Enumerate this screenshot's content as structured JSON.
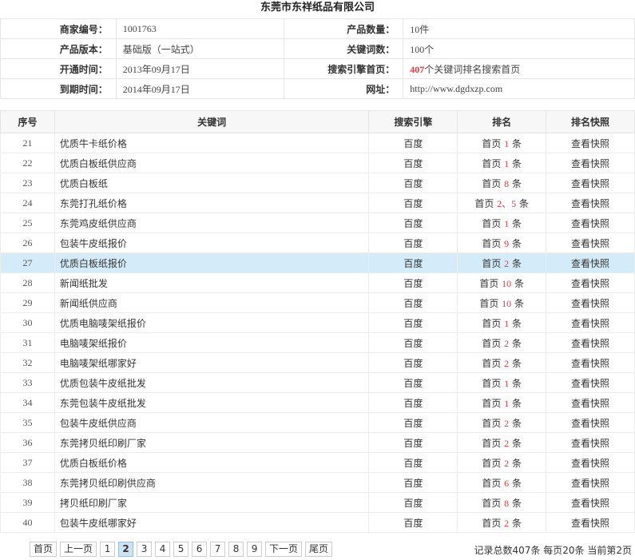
{
  "company": "东莞市东祥纸品有限公司",
  "info": {
    "merchant_id_label": "商家编号：",
    "merchant_id": "1001763",
    "product_count_label": "产品数量：",
    "product_count": "10件",
    "version_label": "产品版本：",
    "version": "基础版（一站式）",
    "keyword_count_label": "关键词数：",
    "keyword_count": "100个",
    "open_time_label": "开通时间：",
    "open_time": "2013年09月17日",
    "homepage_label": "搜索引擎首页：",
    "homepage_count": "407",
    "homepage_text": "个关键词排名搜索首页",
    "expire_label": "到期时间：",
    "expire_time": "2014年09月17日",
    "url_label": "网址：",
    "url": "http://www.dgdxzp.com"
  },
  "table": {
    "headers": [
      "序号",
      "关键词",
      "搜索引擎",
      "排名",
      "排名快照"
    ],
    "rows": [
      {
        "no": "21",
        "keyword": "优质牛卡纸价格",
        "engine": "百度",
        "rank_pre": "首页",
        "rank": "1",
        "rank_post": "条",
        "snapshot": "查看快照"
      },
      {
        "no": "22",
        "keyword": "优质白板纸供应商",
        "engine": "百度",
        "rank_pre": "首页",
        "rank": "1",
        "rank_post": "条",
        "snapshot": "查看快照"
      },
      {
        "no": "23",
        "keyword": "优质白板纸",
        "engine": "百度",
        "rank_pre": "首页",
        "rank": "8",
        "rank_post": "条",
        "snapshot": "查看快照"
      },
      {
        "no": "24",
        "keyword": "东莞打孔纸价格",
        "engine": "百度",
        "rank_pre": "首页",
        "rank": "2、5",
        "rank_post": "条",
        "snapshot": "查看快照"
      },
      {
        "no": "25",
        "keyword": "东莞鸡皮纸供应商",
        "engine": "百度",
        "rank_pre": "首页",
        "rank": "1",
        "rank_post": "条",
        "snapshot": "查看快照"
      },
      {
        "no": "26",
        "keyword": "包装牛皮纸报价",
        "engine": "百度",
        "rank_pre": "首页",
        "rank": "9",
        "rank_post": "条",
        "snapshot": "查看快照"
      },
      {
        "no": "27",
        "keyword": "优质白板纸报价",
        "engine": "百度",
        "rank_pre": "首页",
        "rank": "2",
        "rank_post": "条",
        "snapshot": "查看快照"
      },
      {
        "no": "28",
        "keyword": "新闻纸批发",
        "engine": "百度",
        "rank_pre": "首页",
        "rank": "10",
        "rank_post": "条",
        "snapshot": "查看快照"
      },
      {
        "no": "29",
        "keyword": "新闻纸供应商",
        "engine": "百度",
        "rank_pre": "首页",
        "rank": "10",
        "rank_post": "条",
        "snapshot": "查看快照"
      },
      {
        "no": "30",
        "keyword": "优质电脑唛架纸报价",
        "engine": "百度",
        "rank_pre": "首页",
        "rank": "1",
        "rank_post": "条",
        "snapshot": "查看快照"
      },
      {
        "no": "31",
        "keyword": "电脑唛架纸报价",
        "engine": "百度",
        "rank_pre": "首页",
        "rank": "2",
        "rank_post": "条",
        "snapshot": "查看快照"
      },
      {
        "no": "32",
        "keyword": "电脑唛架纸哪家好",
        "engine": "百度",
        "rank_pre": "首页",
        "rank": "2",
        "rank_post": "条",
        "snapshot": "查看快照"
      },
      {
        "no": "33",
        "keyword": "优质包装牛皮纸批发",
        "engine": "百度",
        "rank_pre": "首页",
        "rank": "1",
        "rank_post": "条",
        "snapshot": "查看快照"
      },
      {
        "no": "34",
        "keyword": "东莞包装牛皮纸批发",
        "engine": "百度",
        "rank_pre": "首页",
        "rank": "1",
        "rank_post": "条",
        "snapshot": "查看快照"
      },
      {
        "no": "35",
        "keyword": "包装牛皮纸供应商",
        "engine": "百度",
        "rank_pre": "首页",
        "rank": "2",
        "rank_post": "条",
        "snapshot": "查看快照"
      },
      {
        "no": "36",
        "keyword": "东莞拷贝纸印刷厂家",
        "engine": "百度",
        "rank_pre": "首页",
        "rank": "2",
        "rank_post": "条",
        "snapshot": "查看快照"
      },
      {
        "no": "37",
        "keyword": "优质白板纸价格",
        "engine": "百度",
        "rank_pre": "首页",
        "rank": "2",
        "rank_post": "条",
        "snapshot": "查看快照"
      },
      {
        "no": "38",
        "keyword": "东莞拷贝纸印刷供应商",
        "engine": "百度",
        "rank_pre": "首页",
        "rank": "6",
        "rank_post": "条",
        "snapshot": "查看快照"
      },
      {
        "no": "39",
        "keyword": "拷贝纸印刷厂家",
        "engine": "百度",
        "rank_pre": "首页",
        "rank": "8",
        "rank_post": "条",
        "snapshot": "查看快照"
      },
      {
        "no": "40",
        "keyword": "包装牛皮纸哪家好",
        "engine": "百度",
        "rank_pre": "首页",
        "rank": "2",
        "rank_post": "条",
        "snapshot": "查看快照"
      }
    ],
    "highlight_color": "#d4ecf9",
    "rank_color": "#e4393c"
  },
  "pager": {
    "first": "首页",
    "prev": "上一页",
    "pages": [
      "1",
      "2",
      "3",
      "4",
      "5",
      "6",
      "7",
      "8",
      "9"
    ],
    "current": "2",
    "next": "下一页",
    "last": "尾页",
    "summary": "记录总数407条 每页20条 当前第2页"
  }
}
